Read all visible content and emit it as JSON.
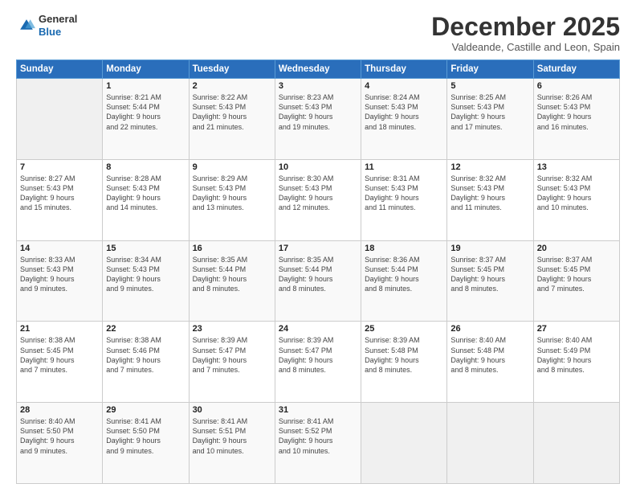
{
  "logo": {
    "general": "General",
    "blue": "Blue"
  },
  "header": {
    "month": "December 2025",
    "location": "Valdeande, Castille and Leon, Spain"
  },
  "weekdays": [
    "Sunday",
    "Monday",
    "Tuesday",
    "Wednesday",
    "Thursday",
    "Friday",
    "Saturday"
  ],
  "weeks": [
    [
      {
        "day": "",
        "info": ""
      },
      {
        "day": "1",
        "info": "Sunrise: 8:21 AM\nSunset: 5:44 PM\nDaylight: 9 hours\nand 22 minutes."
      },
      {
        "day": "2",
        "info": "Sunrise: 8:22 AM\nSunset: 5:43 PM\nDaylight: 9 hours\nand 21 minutes."
      },
      {
        "day": "3",
        "info": "Sunrise: 8:23 AM\nSunset: 5:43 PM\nDaylight: 9 hours\nand 19 minutes."
      },
      {
        "day": "4",
        "info": "Sunrise: 8:24 AM\nSunset: 5:43 PM\nDaylight: 9 hours\nand 18 minutes."
      },
      {
        "day": "5",
        "info": "Sunrise: 8:25 AM\nSunset: 5:43 PM\nDaylight: 9 hours\nand 17 minutes."
      },
      {
        "day": "6",
        "info": "Sunrise: 8:26 AM\nSunset: 5:43 PM\nDaylight: 9 hours\nand 16 minutes."
      }
    ],
    [
      {
        "day": "7",
        "info": "Sunrise: 8:27 AM\nSunset: 5:43 PM\nDaylight: 9 hours\nand 15 minutes."
      },
      {
        "day": "8",
        "info": "Sunrise: 8:28 AM\nSunset: 5:43 PM\nDaylight: 9 hours\nand 14 minutes."
      },
      {
        "day": "9",
        "info": "Sunrise: 8:29 AM\nSunset: 5:43 PM\nDaylight: 9 hours\nand 13 minutes."
      },
      {
        "day": "10",
        "info": "Sunrise: 8:30 AM\nSunset: 5:43 PM\nDaylight: 9 hours\nand 12 minutes."
      },
      {
        "day": "11",
        "info": "Sunrise: 8:31 AM\nSunset: 5:43 PM\nDaylight: 9 hours\nand 11 minutes."
      },
      {
        "day": "12",
        "info": "Sunrise: 8:32 AM\nSunset: 5:43 PM\nDaylight: 9 hours\nand 11 minutes."
      },
      {
        "day": "13",
        "info": "Sunrise: 8:32 AM\nSunset: 5:43 PM\nDaylight: 9 hours\nand 10 minutes."
      }
    ],
    [
      {
        "day": "14",
        "info": "Sunrise: 8:33 AM\nSunset: 5:43 PM\nDaylight: 9 hours\nand 9 minutes."
      },
      {
        "day": "15",
        "info": "Sunrise: 8:34 AM\nSunset: 5:43 PM\nDaylight: 9 hours\nand 9 minutes."
      },
      {
        "day": "16",
        "info": "Sunrise: 8:35 AM\nSunset: 5:44 PM\nDaylight: 9 hours\nand 8 minutes."
      },
      {
        "day": "17",
        "info": "Sunrise: 8:35 AM\nSunset: 5:44 PM\nDaylight: 9 hours\nand 8 minutes."
      },
      {
        "day": "18",
        "info": "Sunrise: 8:36 AM\nSunset: 5:44 PM\nDaylight: 9 hours\nand 8 minutes."
      },
      {
        "day": "19",
        "info": "Sunrise: 8:37 AM\nSunset: 5:45 PM\nDaylight: 9 hours\nand 8 minutes."
      },
      {
        "day": "20",
        "info": "Sunrise: 8:37 AM\nSunset: 5:45 PM\nDaylight: 9 hours\nand 7 minutes."
      }
    ],
    [
      {
        "day": "21",
        "info": "Sunrise: 8:38 AM\nSunset: 5:45 PM\nDaylight: 9 hours\nand 7 minutes."
      },
      {
        "day": "22",
        "info": "Sunrise: 8:38 AM\nSunset: 5:46 PM\nDaylight: 9 hours\nand 7 minutes."
      },
      {
        "day": "23",
        "info": "Sunrise: 8:39 AM\nSunset: 5:47 PM\nDaylight: 9 hours\nand 7 minutes."
      },
      {
        "day": "24",
        "info": "Sunrise: 8:39 AM\nSunset: 5:47 PM\nDaylight: 9 hours\nand 8 minutes."
      },
      {
        "day": "25",
        "info": "Sunrise: 8:39 AM\nSunset: 5:48 PM\nDaylight: 9 hours\nand 8 minutes."
      },
      {
        "day": "26",
        "info": "Sunrise: 8:40 AM\nSunset: 5:48 PM\nDaylight: 9 hours\nand 8 minutes."
      },
      {
        "day": "27",
        "info": "Sunrise: 8:40 AM\nSunset: 5:49 PM\nDaylight: 9 hours\nand 8 minutes."
      }
    ],
    [
      {
        "day": "28",
        "info": "Sunrise: 8:40 AM\nSunset: 5:50 PM\nDaylight: 9 hours\nand 9 minutes."
      },
      {
        "day": "29",
        "info": "Sunrise: 8:41 AM\nSunset: 5:50 PM\nDaylight: 9 hours\nand 9 minutes."
      },
      {
        "day": "30",
        "info": "Sunrise: 8:41 AM\nSunset: 5:51 PM\nDaylight: 9 hours\nand 10 minutes."
      },
      {
        "day": "31",
        "info": "Sunrise: 8:41 AM\nSunset: 5:52 PM\nDaylight: 9 hours\nand 10 minutes."
      },
      {
        "day": "",
        "info": ""
      },
      {
        "day": "",
        "info": ""
      },
      {
        "day": "",
        "info": ""
      }
    ]
  ]
}
